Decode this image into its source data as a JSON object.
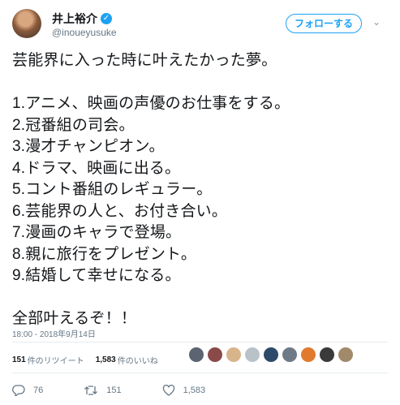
{
  "user": {
    "display_name": "井上裕介",
    "handle": "@inoueyusuke",
    "verified_icon": "verified-badge",
    "follow_label": "フォローする"
  },
  "tweet": {
    "lines": [
      "芸能界に入った時に叶えたかった夢。",
      "",
      "1.アニメ、映画の声優のお仕事をする。",
      "2.冠番組の司会。",
      "3.漫才チャンピオン。",
      "4.ドラマ、映画に出る。",
      "5.コント番組のレギュラー。",
      "6.芸能界の人と、お付き合い。",
      "7.漫画のキャラで登場。",
      "8.親に旅行をプレゼント。",
      "9.結婚して幸せになる。",
      "",
      "全部叶えるぞ！！"
    ],
    "timestamp": "18:00 - 2018年9月14日"
  },
  "stats": {
    "retweets_count": "151",
    "retweets_label": "件のリツイート",
    "likes_count": "1,583",
    "likes_label": "件のいいね"
  },
  "likers": [
    {
      "color": "#5b6470"
    },
    {
      "color": "#8a4a4a"
    },
    {
      "color": "#d8b48a"
    },
    {
      "color": "#b8c2c8"
    },
    {
      "color": "#2e4a6b"
    },
    {
      "color": "#6e7a86"
    },
    {
      "color": "#e27a2e"
    },
    {
      "color": "#3a3a3a"
    },
    {
      "color": "#a08a6a"
    }
  ],
  "actions": {
    "reply_count": "76",
    "retweet_count": "151",
    "like_count": "1,583"
  }
}
